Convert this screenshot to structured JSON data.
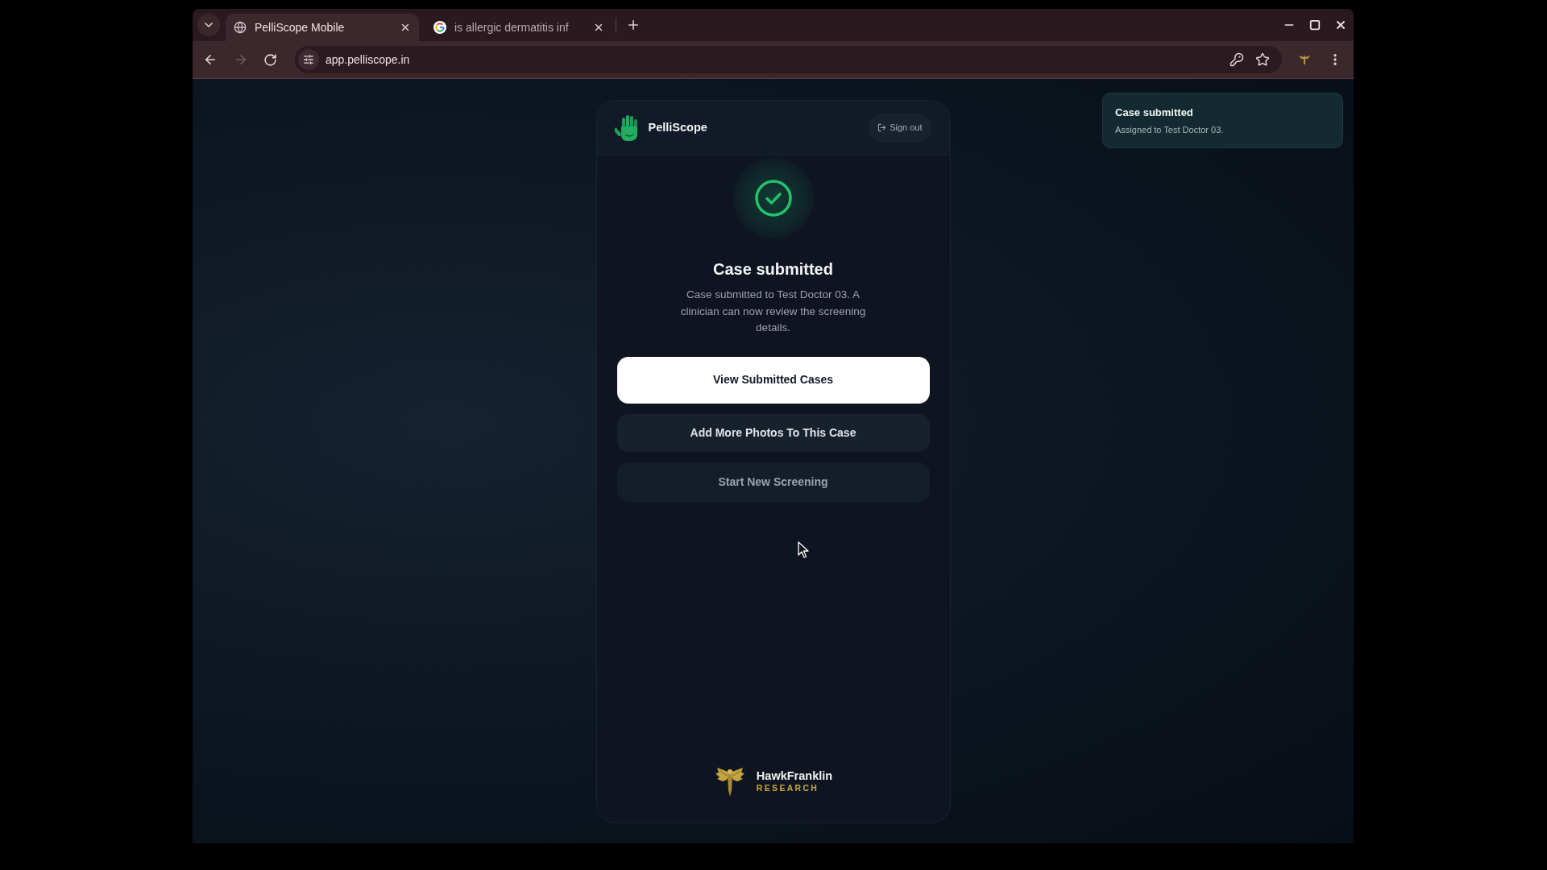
{
  "browser": {
    "tabs": [
      {
        "title": "PelliScope Mobile",
        "selected": true
      },
      {
        "title": "is allergic dermatitis inf",
        "selected": false
      }
    ],
    "forward_button": {
      "disabled": true
    },
    "address": "app.pelliscope.in"
  },
  "app": {
    "brand": "PelliScope",
    "sign_out": "Sign out",
    "heading": "Case submitted",
    "message": "Case submitted to Test Doctor 03. A clinician can now review the screening details.",
    "actions": [
      {
        "label": "View Submitted Cases",
        "kind": "primary"
      },
      {
        "label": "Add More Photos To This Case",
        "kind": "secondary"
      },
      {
        "label": "Start New Screening",
        "kind": "tertiary"
      }
    ],
    "footer": {
      "name": "HawkFranklin",
      "tagline": "RESEARCH"
    }
  },
  "toast": {
    "title": "Case submitted",
    "message": "Assigned to Test Doctor 03."
  }
}
